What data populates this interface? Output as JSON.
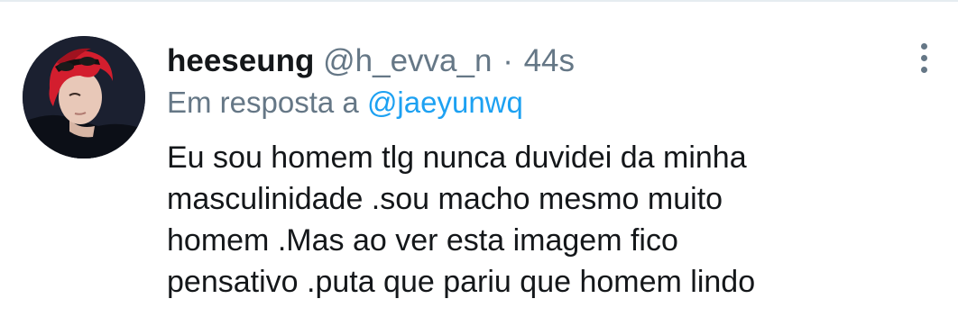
{
  "tweet": {
    "author": {
      "display_name": "heeseung",
      "handle": "@h_evva_n",
      "avatar_icon": "profile-photo"
    },
    "separator": "·",
    "time_ago": "44s",
    "reply": {
      "prefix": "Em resposta a",
      "mention": "@jaeyunwq"
    },
    "text_lines": [
      "Eu sou homem tlg nunca duvidei da minha",
      "masculinidade .sou macho mesmo muito",
      "homem .Mas ao ver esta imagem fico",
      "pensativo .puta que pariu que homem lindo"
    ],
    "more_icon": "vertical-ellipsis-icon"
  },
  "colors": {
    "text_primary": "#14171a",
    "text_secondary": "#657786",
    "link": "#1da1f2",
    "divider": "#e6ecf0"
  }
}
